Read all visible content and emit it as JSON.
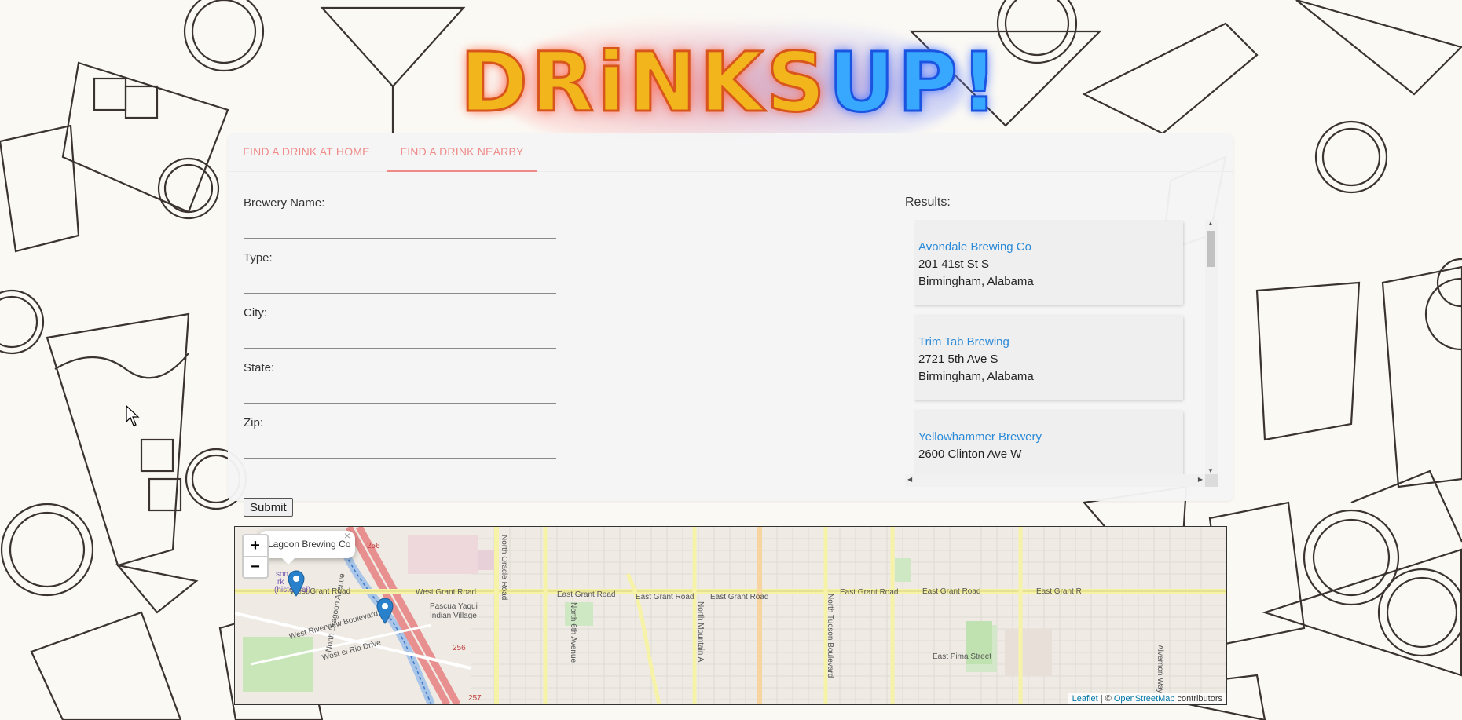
{
  "logo": {
    "part1": "DRiNKS",
    "part2": "UP!"
  },
  "tabs": [
    {
      "label": "FIND A DRINK AT HOME",
      "active": false
    },
    {
      "label": "FIND A DRINK NEARBY",
      "active": true
    }
  ],
  "form": {
    "fields": [
      {
        "label": "Brewery Name:",
        "value": ""
      },
      {
        "label": "Type:",
        "value": ""
      },
      {
        "label": "City:",
        "value": ""
      },
      {
        "label": "State:",
        "value": ""
      },
      {
        "label": "Zip:",
        "value": ""
      }
    ],
    "submit_label": "Submit"
  },
  "results": {
    "heading": "Results:",
    "items": [
      {
        "name": "Avondale Brewing Co",
        "address": "201 41st St S",
        "city_state": "Birmingham, Alabama"
      },
      {
        "name": "Trim Tab Brewing",
        "address": "2721 5th Ave S",
        "city_state": "Birmingham, Alabama"
      },
      {
        "name": "Yellowhammer Brewery",
        "address": "2600 Clinton Ave W",
        "city_state": ""
      }
    ]
  },
  "map": {
    "zoom_in": "+",
    "zoom_out": "−",
    "popup_text": "Lagoon Brewing Co",
    "popup_close": "×",
    "attribution_leaflet": "Leaflet",
    "attribution_sep": " | © ",
    "attribution_osm": "OpenStreetMap",
    "attribution_suffix": " contributors",
    "labels": {
      "west_grant_1": "West Grant Road",
      "west_grant_2": "West Grant Road",
      "east_grant_1": "East Grant Road",
      "east_grant_2": "East Grant Road",
      "east_grant_3": "East Grant Road",
      "east_grant_4": "East Grant Road",
      "east_grant_5": "East Grant Road",
      "east_grant_6": "East Grant R",
      "pascua_1": "Pascua Yaqui",
      "pascua_2": "Indian Village",
      "north_oracle": "North Oracle Road",
      "north_6th": "North 6th Avenue",
      "north_mountain": "North Mountain A",
      "north_tucson": "North Tucson Boulevard",
      "east_pima": "East Pima Street",
      "alvernon": "Alvernon Way",
      "riverview": "West Riverview Boulevard",
      "el_rio": "West el Rio Drive",
      "dragoon": "North Dragoon Avenue",
      "hist_1": "son",
      "hist_2": "rk",
      "hist_3": "(historical)",
      "route_256a": "256",
      "route_256b": "256",
      "route_257": "257"
    },
    "marker_count": 2
  }
}
